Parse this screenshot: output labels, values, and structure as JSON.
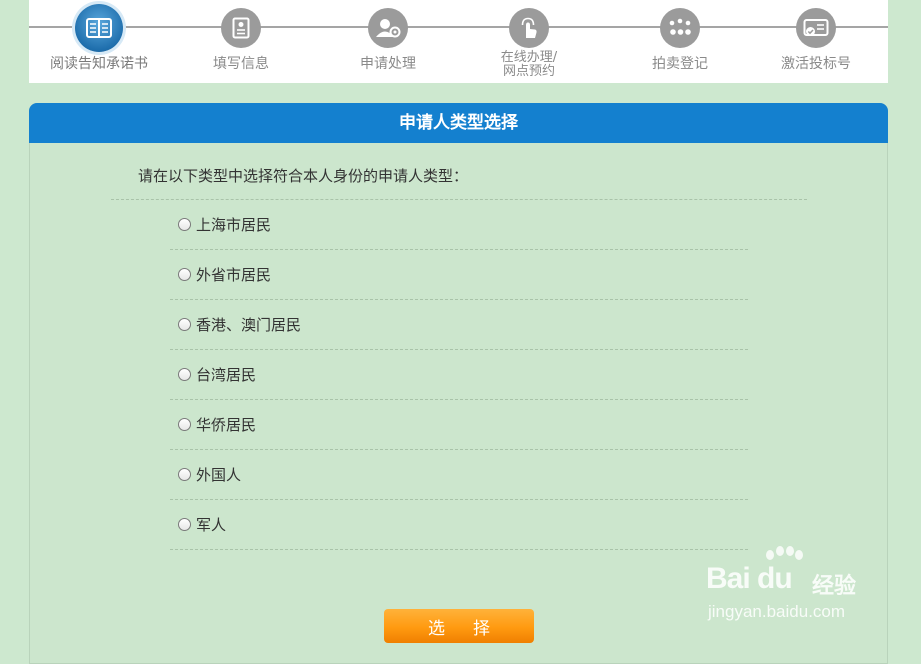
{
  "steps": [
    {
      "label": "阅读告知承诺书",
      "icon": "book-icon",
      "active": true
    },
    {
      "label": "填写信息",
      "icon": "form-icon",
      "active": false
    },
    {
      "label": "申请处理",
      "icon": "user-process-icon",
      "active": false
    },
    {
      "label_line1": "在线办理/",
      "label_line2": "网点预约",
      "icon": "touch-icon",
      "active": false
    },
    {
      "label": "拍卖登记",
      "icon": "dots-icon",
      "active": false
    },
    {
      "label": "激活投标号",
      "icon": "card-icon",
      "active": false
    }
  ],
  "panel": {
    "title": "申请人类型选择",
    "instruction": "请在以下类型中选择符合本人身份的申请人类型：",
    "options": [
      {
        "label": "上海市居民",
        "checked": false
      },
      {
        "label": "外省市居民",
        "checked": false
      },
      {
        "label": "香港、澳门居民",
        "checked": false
      },
      {
        "label": "台湾居民",
        "checked": false
      },
      {
        "label": "华侨居民",
        "checked": false
      },
      {
        "label": "外国人",
        "checked": false
      },
      {
        "label": "军人",
        "checked": false
      }
    ],
    "submit_label": "选择"
  },
  "watermark": {
    "brand": "Bai du",
    "brand_cn": "经验",
    "url": "jingyan.baidu.com"
  },
  "colors": {
    "background": "#cde8cf",
    "header_blue": "#1480cf",
    "active_step": "#1f6fad",
    "inactive_step": "#9b9b9b",
    "button_orange": "#ff9a10"
  }
}
